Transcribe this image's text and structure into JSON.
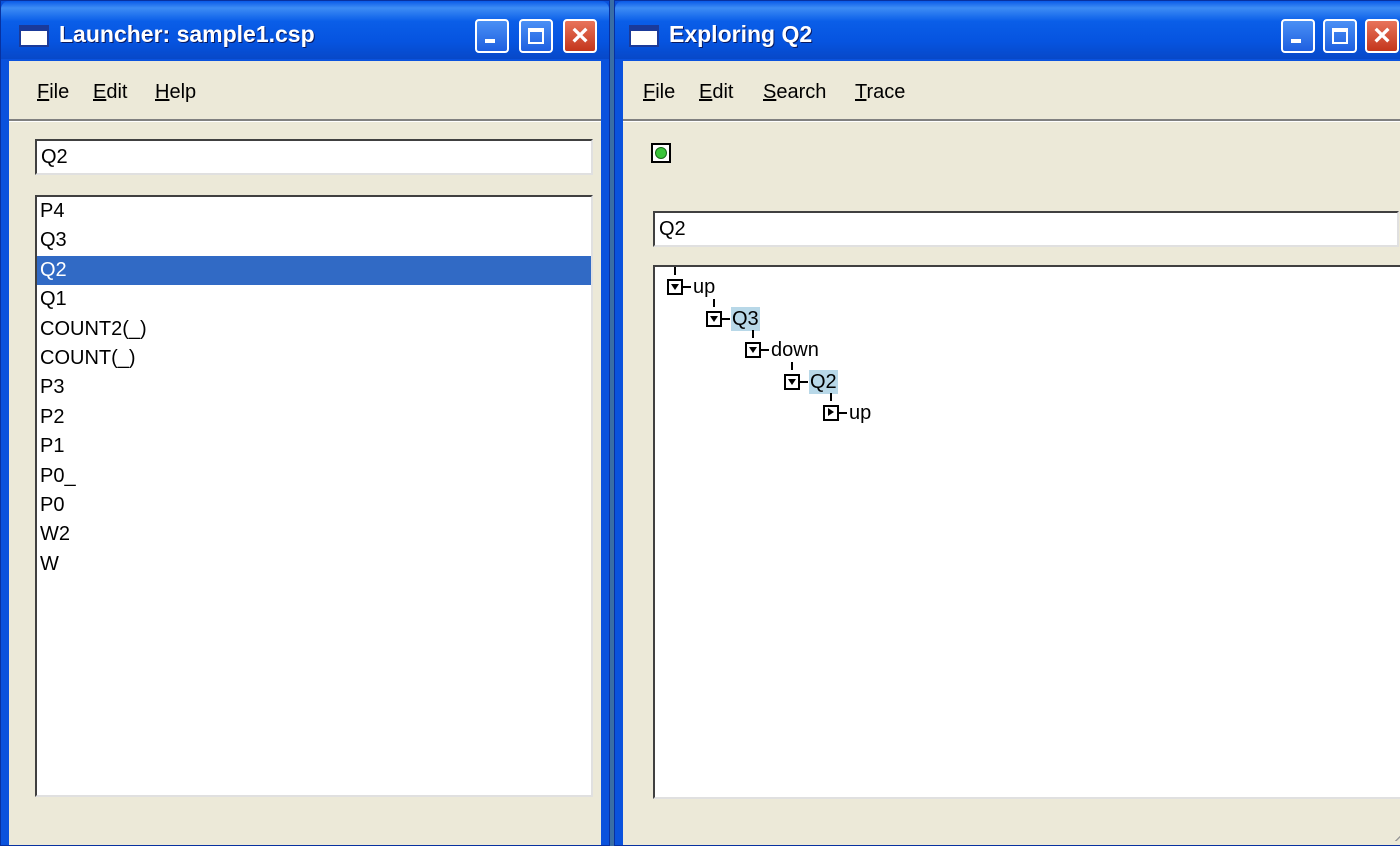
{
  "launcher": {
    "title": "Launcher: sample1.csp",
    "menu": [
      {
        "label_u": "F",
        "label_rest": "ile"
      },
      {
        "label_u": "E",
        "label_rest": "dit"
      },
      {
        "label_u": "H",
        "label_rest": "elp"
      }
    ],
    "input_value": "Q2",
    "processes": [
      "P4",
      "Q3",
      "Q2",
      "Q1",
      "COUNT2(_)",
      "COUNT(_)",
      "P3",
      "P2",
      "P1",
      "P0_",
      "P0",
      "W2",
      "W"
    ],
    "selected_process": "Q2"
  },
  "explorer": {
    "title": "Exploring Q2",
    "menu": [
      {
        "label_u": "F",
        "label_rest": "ile"
      },
      {
        "label_u": "E",
        "label_rest": "dit"
      },
      {
        "label_u": "S",
        "label_rest": "earch"
      },
      {
        "label_u": "T",
        "label_rest": "race"
      }
    ],
    "status": "ok",
    "status_color": "#3ac43a",
    "input_value": "Q2",
    "tree": [
      {
        "label": "up",
        "depth": 0,
        "expanded": true,
        "highlight": false
      },
      {
        "label": "Q3",
        "depth": 1,
        "expanded": true,
        "highlight": true
      },
      {
        "label": "down",
        "depth": 2,
        "expanded": true,
        "highlight": false
      },
      {
        "label": "Q2",
        "depth": 3,
        "expanded": true,
        "highlight": true
      },
      {
        "label": "up",
        "depth": 4,
        "expanded": false,
        "highlight": false
      }
    ]
  },
  "colors": {
    "titlebar": "#0654e0",
    "selection": "#316ac5",
    "tree_highlight": "#b8d8e8",
    "client_bg": "#ece9d8"
  }
}
